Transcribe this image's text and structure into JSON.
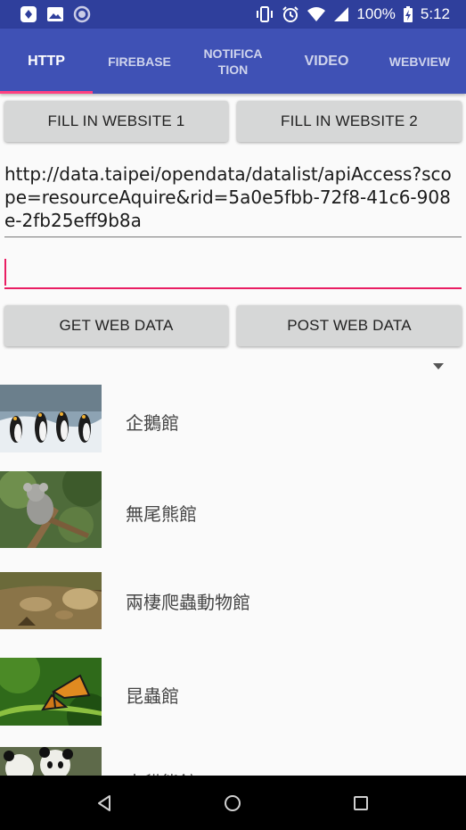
{
  "status_bar": {
    "battery_text": "100%",
    "time": "5:12",
    "background_color": "#2f3f9c"
  },
  "tabs": [
    {
      "label": "HTTP",
      "active": true
    },
    {
      "label": "FIREBASE",
      "active": false
    },
    {
      "label": "NOTIFICA TION",
      "active": false
    },
    {
      "label": "VIDEO",
      "active": false
    },
    {
      "label": "WEBVIEW",
      "active": false
    }
  ],
  "buttons": {
    "fill1": "FILL IN WEBSITE 1",
    "fill2": "FILL IN WEBSITE 2",
    "get": "GET WEB DATA",
    "post": "POST WEB DATA"
  },
  "url_field": {
    "value": "http://data.taipei/opendata/datalist/apiAccess?scope=resourceAquire&rid=5a0e5fbb-72f8-41c6-908e-2fb25eff9b8a"
  },
  "second_field": {
    "value": ""
  },
  "list": [
    {
      "label": "企鵝館",
      "image": "penguins-photo"
    },
    {
      "label": "無尾熊館",
      "image": "koala-photo"
    },
    {
      "label": "兩棲爬蟲動物館",
      "image": "tortoises-photo"
    },
    {
      "label": "昆蟲館",
      "image": "butterfly-photo"
    },
    {
      "label": "大貓熊館",
      "image": "pandas-photo"
    }
  ],
  "colors": {
    "primary": "#3f51b5",
    "primary_dark": "#2f3f9c",
    "accent": "#ff4081",
    "field_focus": "#e91e63"
  }
}
